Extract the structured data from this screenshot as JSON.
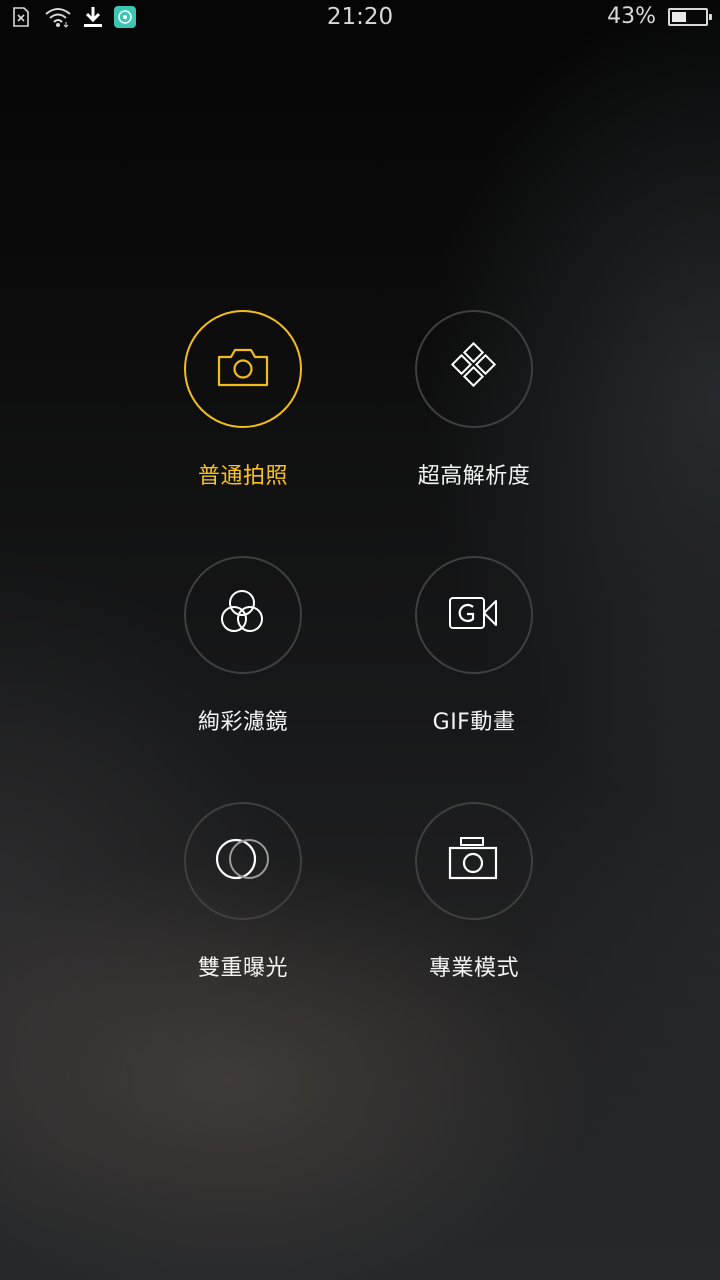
{
  "status_bar": {
    "time": "21:20",
    "battery_percent_label": "43%",
    "battery_level": 0.43,
    "icons": [
      "no-sim-icon",
      "wifi-icon",
      "download-icon",
      "app-notification-icon"
    ]
  },
  "modes": [
    {
      "label": "普通拍照",
      "icon": "camera-icon",
      "active": true
    },
    {
      "label": "超高解析度",
      "icon": "ultra-resolution-icon",
      "active": false
    },
    {
      "label": "絢彩濾鏡",
      "icon": "color-filter-icon",
      "active": false
    },
    {
      "label": "GIF動畫",
      "icon": "gif-video-icon",
      "active": false
    },
    {
      "label": "雙重曝光",
      "icon": "double-exposure-icon",
      "active": false
    },
    {
      "label": "專業模式",
      "icon": "pro-camera-icon",
      "active": false
    }
  ],
  "colors": {
    "accent": "#f7c21f",
    "ring": "#3f3f40",
    "text": "#f4f4f4"
  }
}
